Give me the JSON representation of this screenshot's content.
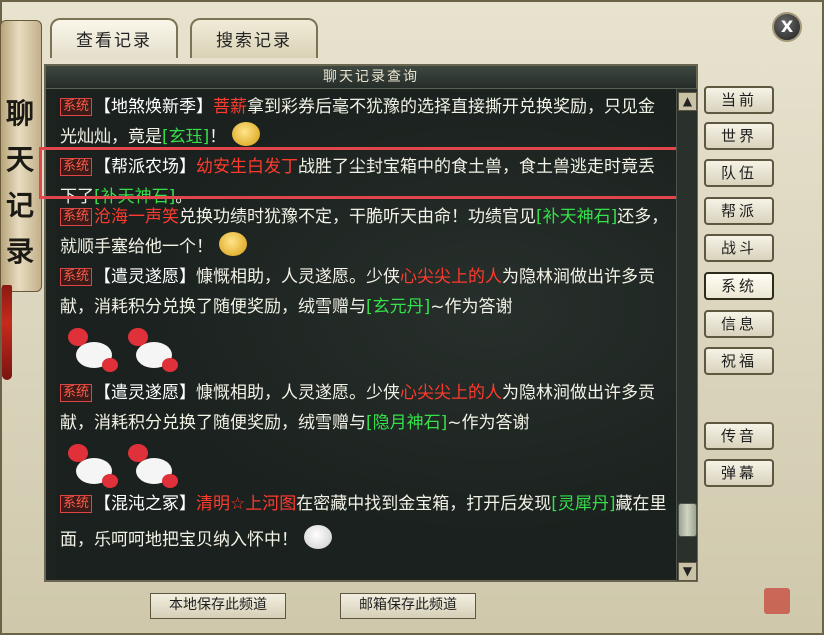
{
  "close_label": "X",
  "scroll_title": [
    "聊",
    "天",
    "记",
    "录"
  ],
  "tabs": [
    {
      "label": "查看记录",
      "active": true
    },
    {
      "label": "搜索记录",
      "active": false
    }
  ],
  "panel_title": "聊天记录查询",
  "tag_label": "系统",
  "messages": [
    {
      "channel": "【地煞焕新季】",
      "name": "菩薪",
      "text": "拿到彩券后毫不犹豫的选择直接撕开兑换奖励，只见金光灿灿，竟是",
      "item": "[玄珏]",
      "tail": "！"
    },
    {
      "channel": "【帮派农场】",
      "name": "幼安生白发丁",
      "text": "战胜了尘封宝箱中的食土兽，食土兽逃走时竟丢下了",
      "item": "[补天神石]",
      "tail": "。"
    },
    {
      "channel": "",
      "name": "沧海一声笑",
      "text": "兑换功绩时犹豫不定，干脆听天由命！功绩官见",
      "item": "[补天神石]",
      "tail": "还多，就顺手塞给他一个！"
    },
    {
      "channel": "【遣灵遂愿】",
      "text_pre": "慷慨相助，人灵遂愿。少侠",
      "name": "心尖尖上的人",
      "text": "为隐林涧做出许多贡献，消耗积分兑换了随便奖励，绒雪赠与",
      "item": "[玄元丹]",
      "tail": "~作为答谢"
    },
    {
      "channel": "【遣灵遂愿】",
      "text_pre": "慷慨相助，人灵遂愿。少侠",
      "name": "心尖尖上的人",
      "text": "为隐林涧做出许多贡献，消耗积分兑换了随便奖励，绒雪赠与",
      "item": "[隐月神石]",
      "tail": "~作为答谢"
    },
    {
      "channel": "【混沌之冢】",
      "name": "清明☆上河图",
      "text": "在密藏中找到金宝箱，打开后发现",
      "item": "[灵犀丹]",
      "tail": "藏在里面，乐呵呵地把宝贝纳入怀中！"
    }
  ],
  "side_buttons": [
    "当前",
    "世界",
    "队伍",
    "帮派",
    "战斗",
    "系统",
    "信息",
    "祝福",
    "传音",
    "弹幕"
  ],
  "active_side": "系统",
  "bottom_buttons": [
    "本地保存此频道",
    "邮箱保存此频道"
  ],
  "scroll_up": "▲",
  "scroll_down": "▼"
}
